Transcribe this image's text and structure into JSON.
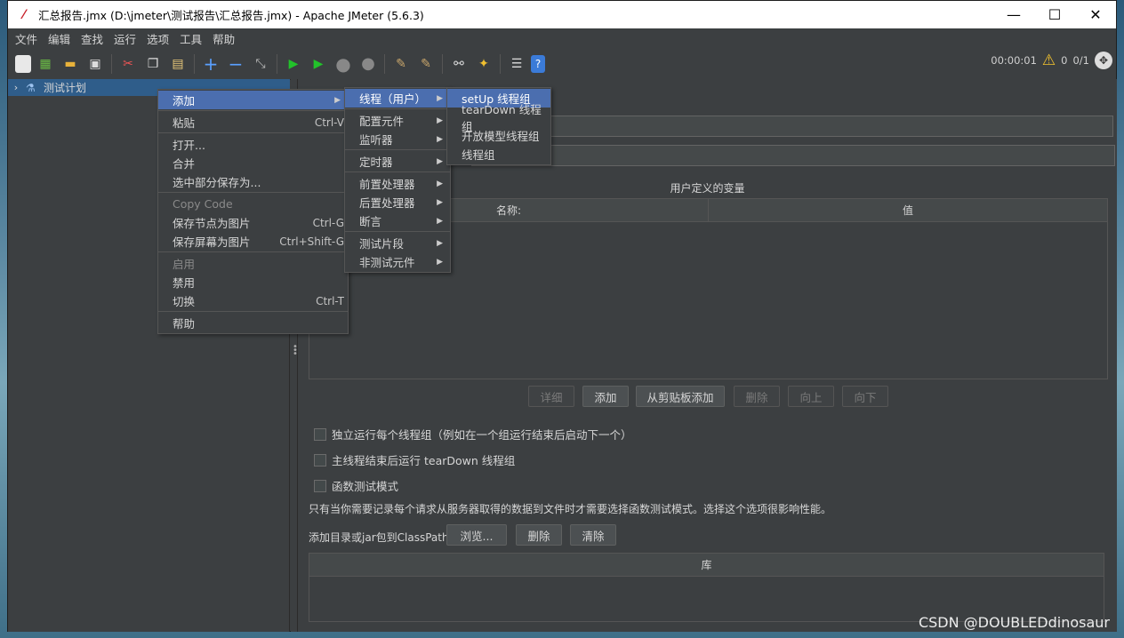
{
  "window": {
    "title": "汇总报告.jmx (D:\\jmeter\\测试报告\\汇总报告.jmx) - Apache JMeter (5.6.3)",
    "controls": [
      "—",
      "☐",
      "✕"
    ]
  },
  "menubar": [
    "文件",
    "编辑",
    "查找",
    "运行",
    "选项",
    "工具",
    "帮助"
  ],
  "toolbar_status": {
    "time": "00:00:01",
    "warn_count": "0",
    "threads": "0/1"
  },
  "tree": {
    "root_label": "测试计划"
  },
  "main": {
    "section_title": "用户定义的变量",
    "table_cols": [
      "名称:",
      "值"
    ],
    "buttons": [
      "详细",
      "添加",
      "从剪贴板添加",
      "删除",
      "向上",
      "向下"
    ],
    "checkboxes": [
      "独立运行每个线程组（例如在一个组运行结束后启动下一个）",
      "主线程结束后运行 tearDown 线程组",
      "函数测试模式"
    ],
    "note": "只有当你需要记录每个请求从服务器取得的数据到文件时才需要选择函数测试模式。选择这个选项很影响性能。",
    "classpath_label": "添加目录或jar包到ClassPath",
    "classpath_buttons": [
      "浏览...",
      "删除",
      "清除"
    ],
    "lib_col": "库"
  },
  "context_menu": {
    "items": [
      {
        "label": "添加",
        "shortcut": "",
        "submenu": true
      },
      {
        "label": "粘贴",
        "shortcut": "Ctrl-V"
      },
      {
        "label": "打开...",
        "shortcut": ""
      },
      {
        "label": "合并",
        "shortcut": ""
      },
      {
        "label": "选中部分保存为...",
        "shortcut": ""
      },
      {
        "label": "Copy Code",
        "shortcut": ""
      },
      {
        "label": "保存节点为图片",
        "shortcut": "Ctrl-G"
      },
      {
        "label": "保存屏幕为图片",
        "shortcut": "Ctrl+Shift-G"
      },
      {
        "label": "启用",
        "shortcut": ""
      },
      {
        "label": "禁用",
        "shortcut": ""
      },
      {
        "label": "切换",
        "shortcut": "Ctrl-T"
      },
      {
        "label": "帮助",
        "shortcut": ""
      }
    ]
  },
  "add_submenu": [
    "线程（用户）",
    "配置元件",
    "监听器",
    "定时器",
    "前置处理器",
    "后置处理器",
    "断言",
    "测试片段",
    "非测试元件"
  ],
  "thread_submenu": [
    "setUp 线程组",
    "tearDown 线程组",
    "开放模型线程组",
    "线程组"
  ],
  "watermark": "CSDN @DOUBLEDdinosaur"
}
